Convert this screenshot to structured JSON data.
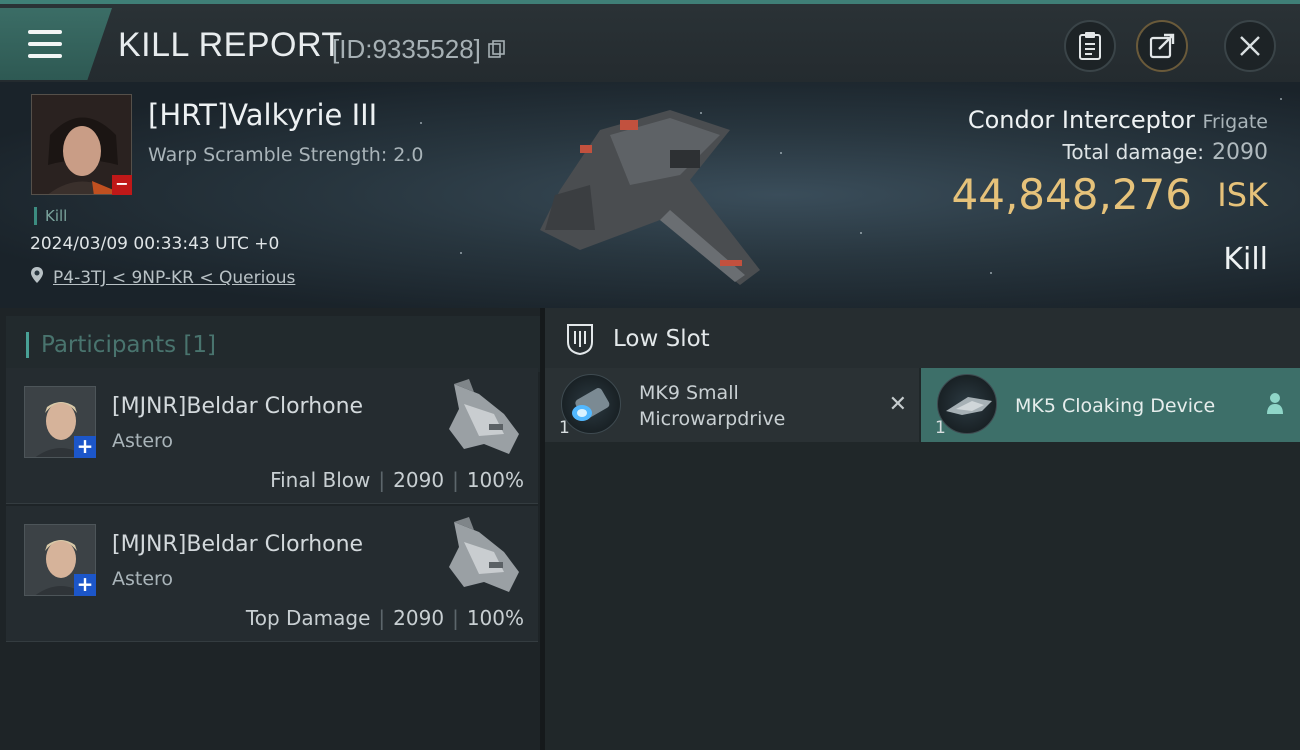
{
  "header": {
    "title": "KILL REPORT",
    "report_id": "[ID:9335528]"
  },
  "victim": {
    "name": "[HRT]Valkyrie III",
    "warp_scramble": "Warp Scramble Strength: 2.0",
    "tag": "Kill",
    "datetime": "2024/03/09 00:33:43 UTC +0",
    "location": "P4-3TJ < 9NP-KR < Querious",
    "ship_name": "Condor Interceptor",
    "ship_class": "Frigate",
    "total_damage_label": "Total damage:",
    "total_damage": "2090",
    "isk_value": "44,848,276",
    "isk_unit": "ISK",
    "result": "Kill"
  },
  "participants": {
    "label": "Participants [1]",
    "rows": [
      {
        "name": "[MJNR]Beldar Clorhone",
        "ship": "Astero",
        "role": "Final Blow",
        "damage": "2090",
        "percent": "100%"
      },
      {
        "name": "[MJNR]Beldar Clorhone",
        "ship": "Astero",
        "role": "Top Damage",
        "damage": "2090",
        "percent": "100%"
      }
    ]
  },
  "low_slot": {
    "title": "Low Slot",
    "modules": [
      {
        "name": "MK9 Small Microwarpdrive",
        "qty": "1",
        "status": "destroyed"
      },
      {
        "name": "MK5 Cloaking Device",
        "qty": "1",
        "status": "dropped"
      }
    ]
  },
  "colors": {
    "accent": "#3d6f69",
    "isk": "#e6c27a",
    "minus_badge": "#c01818",
    "plus_badge": "#1c56c9"
  }
}
